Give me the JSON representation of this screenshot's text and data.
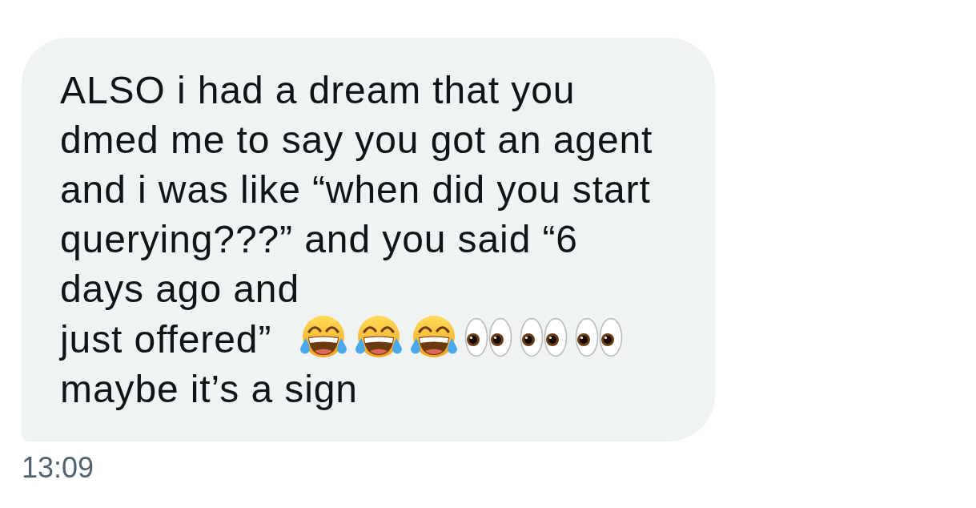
{
  "message": {
    "blocks": [
      {
        "text": "ALSO i had a dream that you\ndmed me to say you got an agent\nand i was like “when did you start\nquerying???” and you said “6\ndays ago and"
      },
      {
        "text": "just offered”",
        "emojis": [
          {
            "kind": "laughing-tears"
          },
          {
            "kind": "laughing-tears"
          },
          {
            "kind": "laughing-tears"
          },
          {
            "kind": "eyes"
          },
          {
            "kind": "eyes"
          },
          {
            "kind": "eyes"
          }
        ]
      },
      {
        "text": "maybe it’s a sign"
      }
    ]
  },
  "timestamp": "13:09"
}
